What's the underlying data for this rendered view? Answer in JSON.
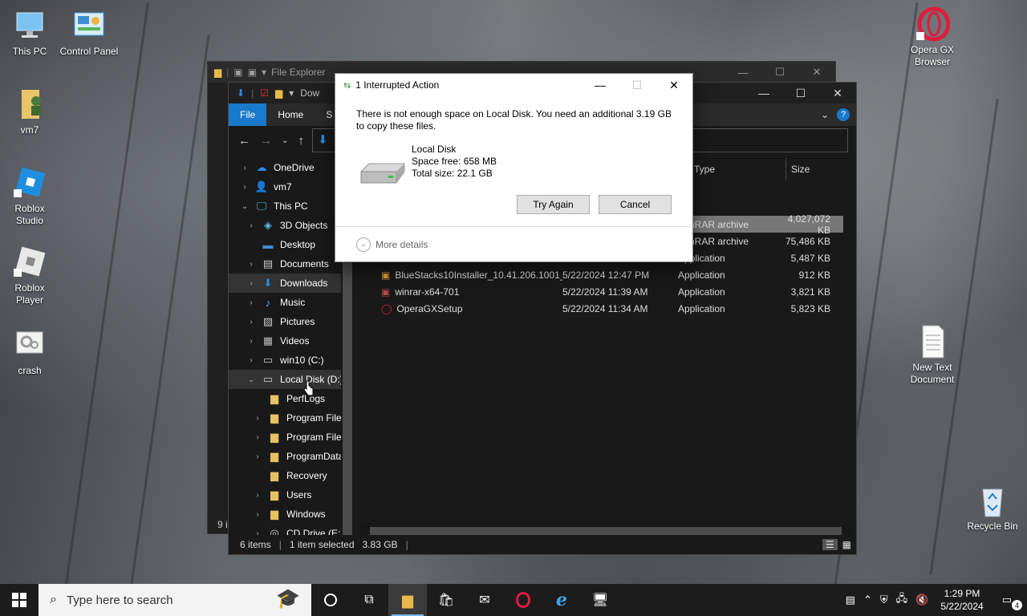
{
  "desktop": {
    "icons": [
      {
        "label": "This PC"
      },
      {
        "label": "Control Panel"
      },
      {
        "label": "vm7"
      },
      {
        "label": "Roblox Studio"
      },
      {
        "label": "Roblox Player"
      },
      {
        "label": "crash"
      },
      {
        "label": "Opera GX Browser"
      },
      {
        "label": "New Text Document"
      },
      {
        "label": "Recycle Bin"
      }
    ]
  },
  "back_window": {
    "title": "File Explorer",
    "status": "9 i"
  },
  "explorer": {
    "title_partial": "Dow",
    "ribbon_tabs": [
      "File",
      "Home",
      "S"
    ],
    "help": "?",
    "nav": [
      {
        "label": "OneDrive",
        "chev": "›",
        "icon": "cloud-icon"
      },
      {
        "label": "vm7",
        "chev": "›",
        "icon": "user-icon"
      },
      {
        "label": "This PC",
        "chev": "⌄",
        "icon": "monitor-icon"
      },
      {
        "label": "3D Objects",
        "chev": "›",
        "icon": "cube-icon"
      },
      {
        "label": "Desktop",
        "chev": "",
        "icon": "desktop-icon"
      },
      {
        "label": "Documents",
        "chev": "›",
        "icon": "document-icon"
      },
      {
        "label": "Downloads",
        "chev": "›",
        "icon": "download-icon"
      },
      {
        "label": "Music",
        "chev": "›",
        "icon": "music-icon"
      },
      {
        "label": "Pictures",
        "chev": "›",
        "icon": "pictures-icon"
      },
      {
        "label": "Videos",
        "chev": "›",
        "icon": "video-icon"
      },
      {
        "label": "win10 (C:)",
        "chev": "›",
        "icon": "drive-icon"
      },
      {
        "label": "Local Disk (D:)",
        "chev": "⌄",
        "icon": "drive-icon"
      },
      {
        "label": "PerfLogs",
        "chev": "",
        "icon": "folder-icon"
      },
      {
        "label": "Program Files",
        "chev": "›",
        "icon": "folder-icon"
      },
      {
        "label": "Program Files",
        "chev": "›",
        "icon": "folder-icon"
      },
      {
        "label": "ProgramData",
        "chev": "›",
        "icon": "folder-icon"
      },
      {
        "label": "Recovery",
        "chev": "",
        "icon": "folder-icon"
      },
      {
        "label": "Users",
        "chev": "›",
        "icon": "folder-icon"
      },
      {
        "label": "Windows",
        "chev": "›",
        "icon": "folder-icon"
      },
      {
        "label": "CD Drive (E:)",
        "chev": "›",
        "icon": "cd-icon"
      }
    ],
    "columns": {
      "type": "Type",
      "size": "Size"
    },
    "files": [
      {
        "name": "",
        "date": "",
        "type": "WinRAR archive",
        "size": "4,027,072 KB",
        "selected": true
      },
      {
        "name": "",
        "date": "",
        "type": "WinRAR archive",
        "size": "75,486 KB",
        "selected": false
      },
      {
        "name": "",
        "date": "",
        "type": "Application",
        "size": "5,487 KB",
        "selected": false
      },
      {
        "name": "BlueStacks10Installer_10.41.206.1001_n...",
        "date": "5/22/2024 12:47 PM",
        "type": "Application",
        "size": "912 KB",
        "selected": false
      },
      {
        "name": "winrar-x64-701",
        "date": "5/22/2024 11:39 AM",
        "type": "Application",
        "size": "3,821 KB",
        "selected": false
      },
      {
        "name": "OperaGXSetup",
        "date": "5/22/2024 11:34 AM",
        "type": "Application",
        "size": "5,823 KB",
        "selected": false
      }
    ],
    "status": {
      "items": "6 items",
      "selected": "1 item selected",
      "size": "3.83 GB"
    }
  },
  "dialog": {
    "title": "1 Interrupted Action",
    "message": "There is not enough space on Local Disk. You need an additional 3.19 GB to copy these files.",
    "drive_name": "Local Disk",
    "space_free": "Space free: 658 MB",
    "total_size": "Total size: 22.1 GB",
    "try_again": "Try Again",
    "cancel": "Cancel",
    "more_details": "More details"
  },
  "taskbar": {
    "search_placeholder": "Type here to search",
    "time": "1:29 PM",
    "date": "5/22/2024",
    "notifications": "4"
  }
}
